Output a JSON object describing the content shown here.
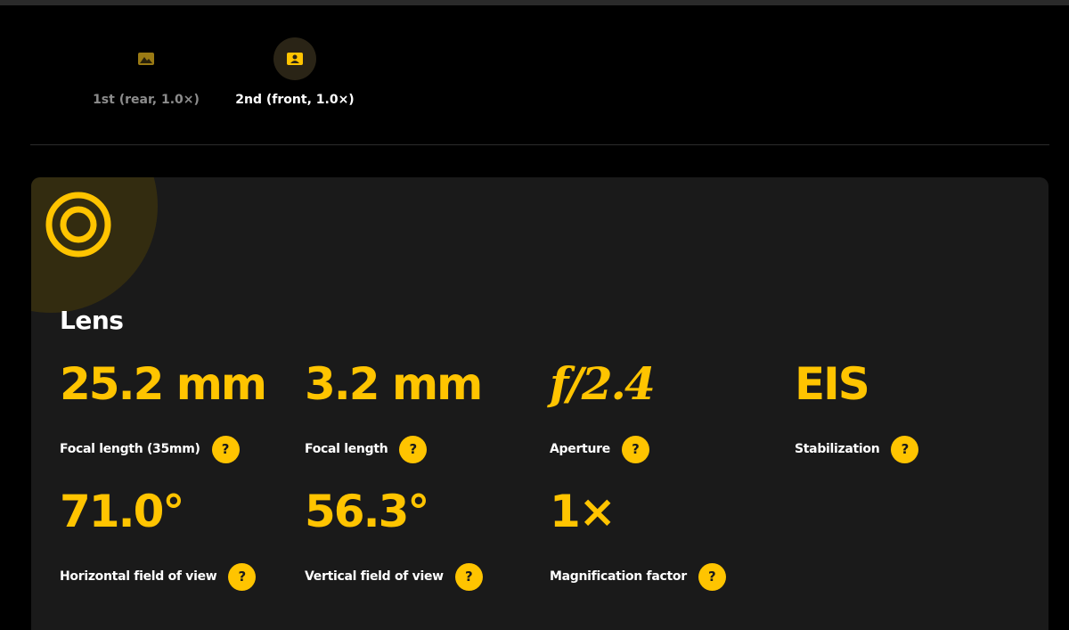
{
  "camera_tabs": [
    {
      "label": "1st (rear, 1.0×)",
      "icon": "landscape-photo-icon",
      "active": false
    },
    {
      "label": "2nd (front, 1.0×)",
      "icon": "portrait-photo-icon",
      "active": true
    }
  ],
  "lens": {
    "title": "Lens",
    "icon": "lens-icon",
    "specs": [
      {
        "value": "25.2 mm",
        "label": "Focal length (35mm)"
      },
      {
        "value": "3.2 mm",
        "label": "Focal length"
      },
      {
        "value": "f/2.4",
        "label": "Aperture"
      },
      {
        "value": "EIS",
        "label": "Stabilization"
      },
      {
        "value": "71.0°",
        "label": "Horizontal field of view"
      },
      {
        "value": "56.3°",
        "label": "Vertical field of view"
      },
      {
        "value": "1×",
        "label": "Magnification factor"
      }
    ],
    "help_symbol": "?"
  },
  "colors": {
    "accent": "#ffc400",
    "card_background": "#1a1a1a",
    "page_background": "#000000",
    "inactive_text": "#8c8c8c"
  }
}
